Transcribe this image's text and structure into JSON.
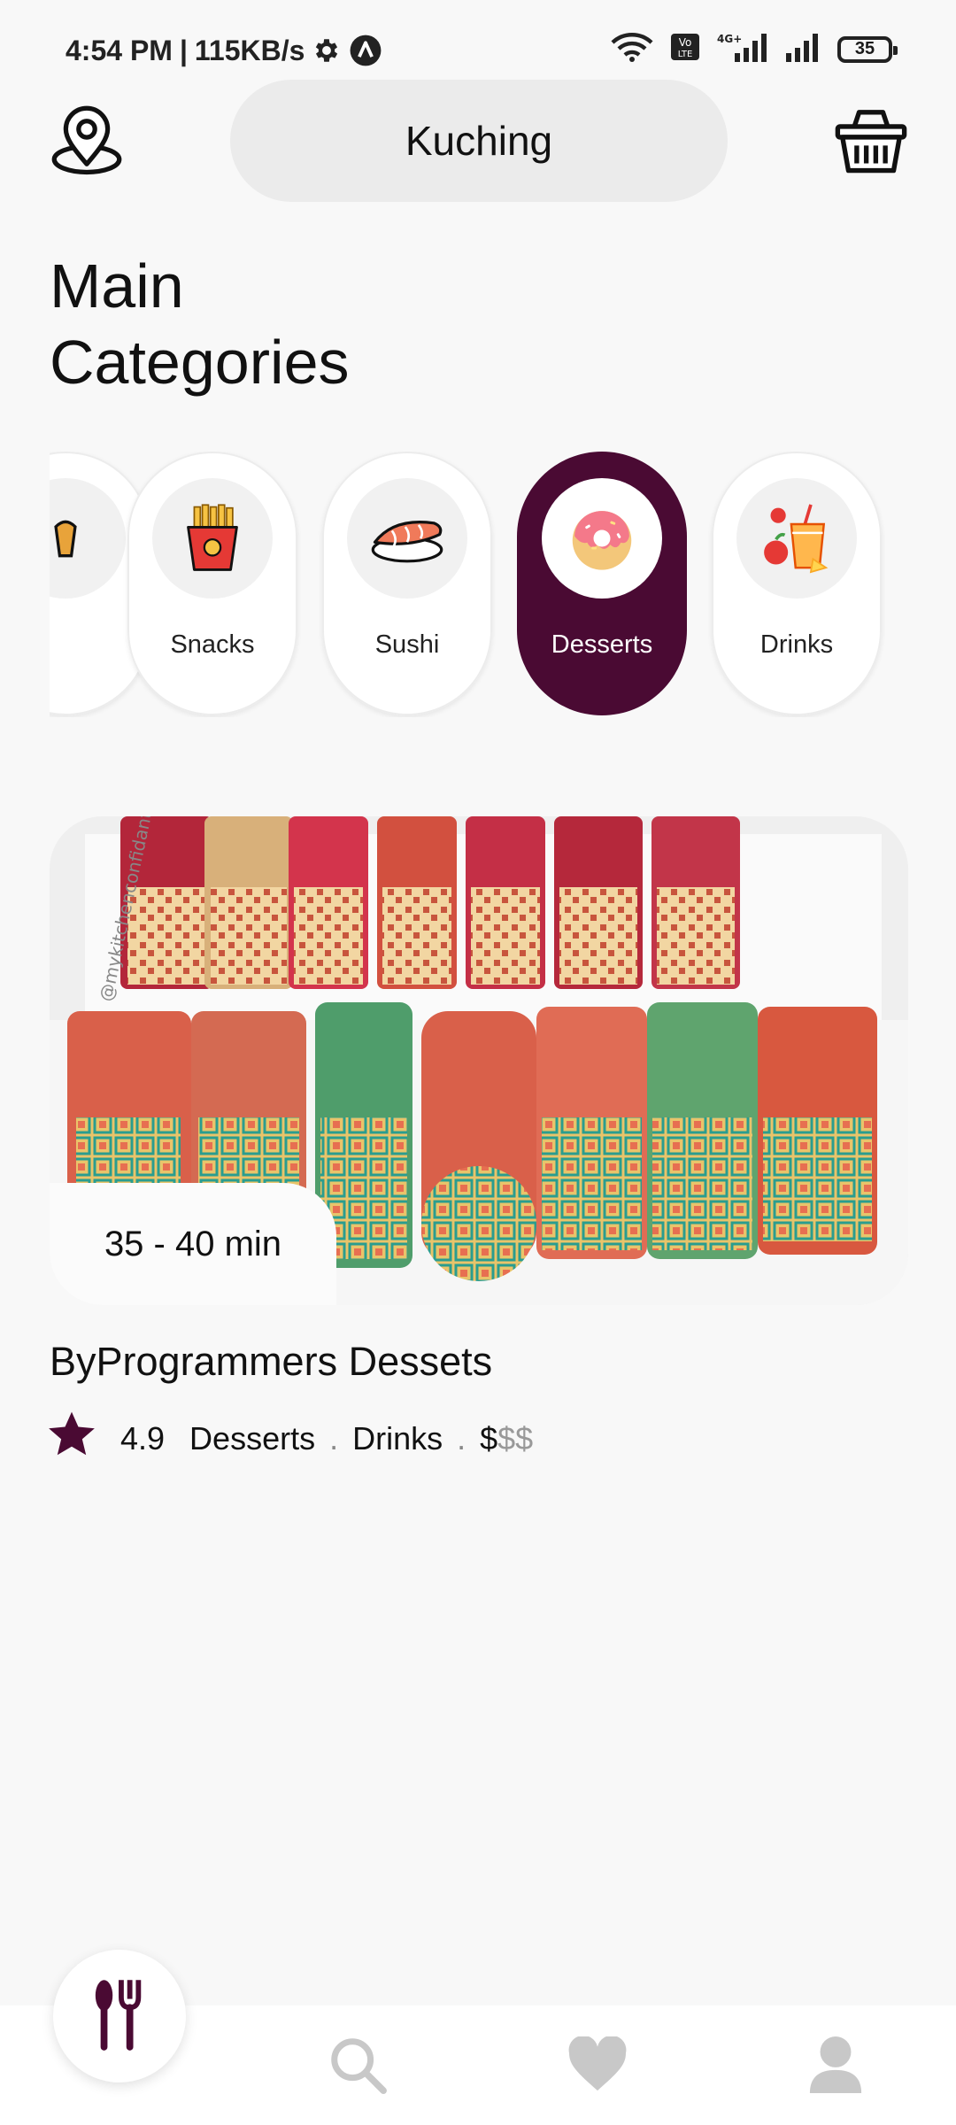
{
  "status_bar": {
    "time": "4:54 PM",
    "separator": "|",
    "speed": "115KB/s",
    "battery": "35"
  },
  "header": {
    "location_icon": "location-pin-icon",
    "city": "Kuching",
    "cart_icon": "shopping-basket-icon"
  },
  "page": {
    "title_line1": "Main",
    "title_line2": "Categories"
  },
  "categories": [
    {
      "label": "Snacks",
      "icon": "fries-icon"
    },
    {
      "label": "Sushi",
      "icon": "sushi-icon"
    },
    {
      "label": "Desserts",
      "icon": "donut-icon",
      "active": true
    },
    {
      "label": "Drinks",
      "icon": "drink-icon"
    }
  ],
  "restaurant": {
    "time": "35 - 40 min",
    "name": "ByProgrammers Dessets",
    "rating": "4.9",
    "tags": [
      "Desserts",
      "Drinks"
    ],
    "dot": ".",
    "price_active": "$",
    "price_inactive": "$$",
    "image_watermark": "@mykitchenconfidante"
  },
  "bottom_nav": {
    "items": [
      "home-cutlery-icon",
      "search-icon",
      "heart-icon",
      "user-icon"
    ]
  },
  "colors": {
    "primary": "#4a0a33",
    "background": "#f8f8f8",
    "inactive_icon": "#c8c8c8"
  }
}
